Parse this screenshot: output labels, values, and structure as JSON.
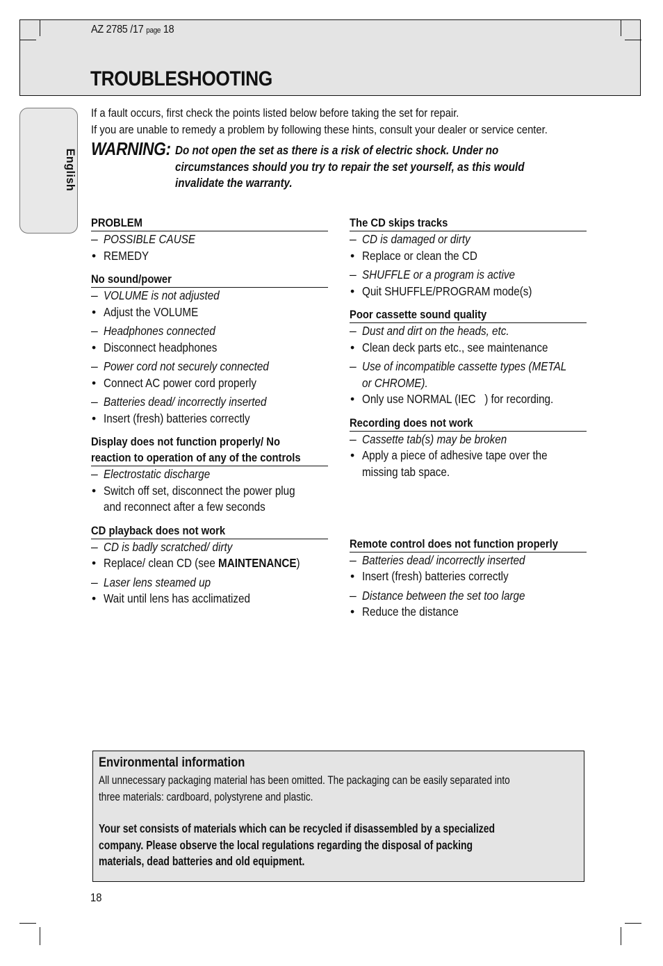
{
  "header": {
    "doc_ref": "AZ 2785 /17",
    "page_label": "page",
    "page_ref": "18",
    "title": "TROUBLESHOOTING"
  },
  "language_tab": "English",
  "intro": {
    "line1": "If a fault occurs, first check the points listed below before taking the set for repair.",
    "line2": "If you are unable to remedy a problem by following these hints, consult your dealer or service center."
  },
  "warning": {
    "label": "WARNING:",
    "lines": [
      "Do not open the set as there is a risk of electric shock. Under no",
      "circumstances should you try to repair the set yourself, as this would",
      "invalidate the warranty."
    ]
  },
  "left_column": [
    {
      "heading": "PROBLEM",
      "items": [
        {
          "cause": "POSSIBLE CAUSE",
          "remedy": "REMEDY"
        }
      ]
    },
    {
      "heading": "No sound/power",
      "items": [
        {
          "cause": "VOLUME is not adjusted",
          "remedy": "Adjust the VOLUME"
        },
        {
          "cause": "Headphones connected",
          "remedy": "Disconnect headphones"
        },
        {
          "cause": "Power cord not securely connected",
          "remedy": "Connect AC power cord properly"
        },
        {
          "cause": "Batteries dead/ incorrectly inserted",
          "remedy": "Insert (fresh) batteries correctly"
        }
      ]
    },
    {
      "heading_lines": [
        "Display does not function properly/ No",
        "reaction to operation of any of the controls"
      ],
      "items": [
        {
          "cause": "Electrostatic discharge",
          "remedy_lines": [
            "Switch off set, disconnect the power plug",
            "and reconnect after a few seconds"
          ]
        }
      ]
    },
    {
      "heading": "CD playback does not work",
      "items": [
        {
          "cause": "CD is badly scratched/ dirty",
          "remedy_pre": "Replace/ clean CD (see ",
          "remedy_bold": "MAINTENANCE",
          "remedy_post": ")"
        },
        {
          "cause": "Laser lens steamed up",
          "remedy": "Wait until lens has acclimatized"
        }
      ]
    }
  ],
  "right_column": [
    {
      "heading": "The CD skips tracks",
      "items": [
        {
          "cause": "CD is damaged or dirty",
          "remedy": "Replace or clean the CD"
        },
        {
          "cause": "SHUFFLE or a program is active",
          "remedy": "Quit SHUFFLE/PROGRAM mode(s)"
        }
      ]
    },
    {
      "heading": "Poor cassette sound quality",
      "items": [
        {
          "cause": "Dust and dirt on the heads, etc.",
          "remedy": "Clean deck parts etc., see maintenance"
        },
        {
          "cause_lines": [
            "Use of incompatible cassette types (METAL",
            "or CHROME)."
          ],
          "remedy": "Only use NORMAL (IEC   ) for recording."
        }
      ]
    },
    {
      "heading": "Recording does not work",
      "items": [
        {
          "cause": "Cassette tab(s) may be broken",
          "remedy_lines": [
            "Apply a piece of adhesive tape over the",
            "missing tab space."
          ]
        }
      ]
    },
    {
      "heading": "Remote control does not function properly",
      "items": [
        {
          "cause": "Batteries dead/ incorrectly inserted",
          "remedy": "Insert (fresh) batteries correctly"
        },
        {
          "cause": "Distance between the set too large",
          "remedy": "Reduce the distance"
        }
      ]
    }
  ],
  "environment": {
    "title": "Environmental information",
    "body_lines": [
      "All unnecessary packaging material has been omitted. The packaging can be easily separated into",
      "three materials: cardboard, polystyrene and plastic."
    ],
    "bold_lines": [
      "Your set consists of materials which can be recycled if disassembled by a specialized",
      "company. Please observe the local regulations regarding the disposal of packing",
      "materials, dead batteries and old equipment."
    ]
  },
  "footer": {
    "page_number": "18"
  }
}
